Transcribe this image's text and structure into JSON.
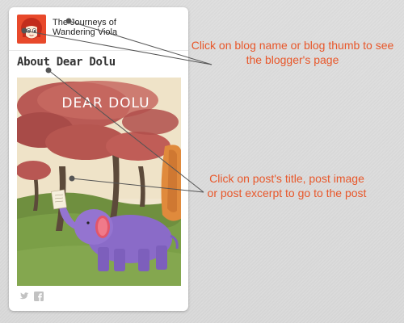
{
  "blog": {
    "name": "The Journeys of Wandering Viola",
    "thumb_icon": "girl-avatar-icon"
  },
  "post": {
    "title": "About Dear Dolu",
    "image_text": "DEAR DOLU"
  },
  "social": {
    "twitter_icon": "twitter-icon",
    "facebook_icon": "facebook-icon"
  },
  "callouts": {
    "blog": "Click on blog name or blog thumb to see the blogger's page",
    "post": "Click on post's title, post image or post excerpt to go to the post"
  },
  "colors": {
    "callout": "#e8572a",
    "pointer": "#555555",
    "card": "#ffffff"
  }
}
